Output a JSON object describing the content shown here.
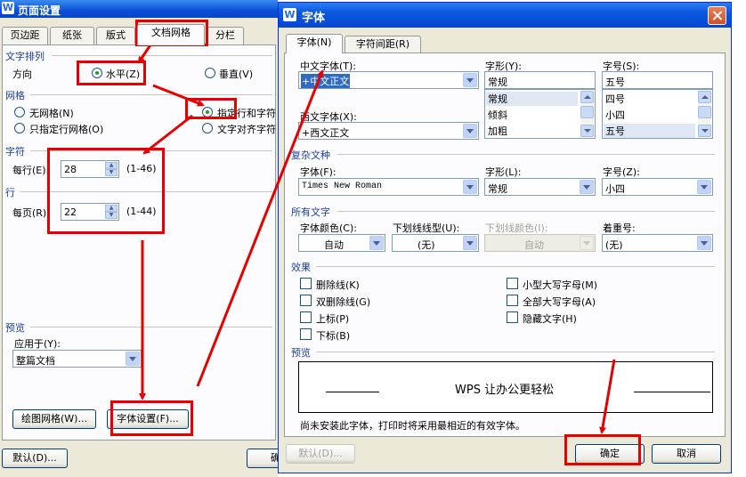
{
  "page_setup": {
    "title": "页面设置",
    "tabs": [
      "页边距",
      "纸张",
      "版式",
      "文档网格",
      "分栏"
    ],
    "text_direction": {
      "section": "文字排列",
      "label": "方向",
      "horizontal": "水平(Z)",
      "vertical": "垂直(V)"
    },
    "grid": {
      "section": "网格",
      "no_grid": "无网格(N)",
      "line_grid": "只指定行网格(O)",
      "line_char_grid": "指定行和字符",
      "snap_char_grid": "文字对齐字符"
    },
    "chars": {
      "section": "字符",
      "label": "每行(E):",
      "value": "28",
      "range": "(1-46)"
    },
    "lines": {
      "section": "行",
      "label": "每页(R):",
      "value": "22",
      "range": "(1-44)"
    },
    "preview": {
      "section": "预览",
      "apply_label": "应用于(Y):",
      "apply_value": "整篇文档"
    },
    "draw_grid_button": "绘图网格(W)...",
    "font_settings_button": "字体设置(F)...",
    "default_button": "默认(D)...",
    "ok_button_partial": "确"
  },
  "font_dialog": {
    "title": "字体",
    "tabs": [
      "字体(N)",
      "字符间距(R)"
    ],
    "chinese_font": {
      "label": "中文字体(T):",
      "value": "+中文正文"
    },
    "western_font": {
      "label": "西文字体(X):",
      "value": "+西文正文"
    },
    "style": {
      "label": "字形(Y):",
      "value": "常规",
      "options": [
        "常规",
        "倾斜",
        "加粗"
      ]
    },
    "size": {
      "label": "字号(S):",
      "value": "五号",
      "options": [
        "四号",
        "小四",
        "五号"
      ]
    },
    "complex": {
      "section": "复杂文种",
      "font_label": "字体(F):",
      "font_value": "Times New Roman",
      "style_label": "字形(L):",
      "style_value": "常规",
      "size_label": "字号(Z):",
      "size_value": "小四"
    },
    "all_text": {
      "section": "所有文字",
      "color_label": "字体颜色(C):",
      "color_value": "自动",
      "underline_label": "下划线线型(U):",
      "underline_value": "(无)",
      "underline_color_label": "下划线颜色(I):",
      "underline_color_value": "自动",
      "emphasis_label": "着重号:",
      "emphasis_value": "(无)"
    },
    "effects": {
      "section": "效果",
      "left": [
        "删除线(K)",
        "双删除线(G)",
        "上标(P)",
        "下标(B)"
      ],
      "right": [
        "小型大写字母(M)",
        "全部大写字母(A)",
        "隐藏文字(H)"
      ]
    },
    "preview": {
      "section": "预览",
      "text": "WPS 让办公更轻松"
    },
    "note": "尚未安装此字体，打印时将采用最相近的有效字体。",
    "default_button": "默认(D)...",
    "ok_button": "确定",
    "cancel_button": "取消"
  },
  "colors": {
    "annotation_red": "#e60000",
    "title_blue": "#0a57e0",
    "selection_blue": "#316ac5",
    "group_blue": "#1a3ea6"
  }
}
